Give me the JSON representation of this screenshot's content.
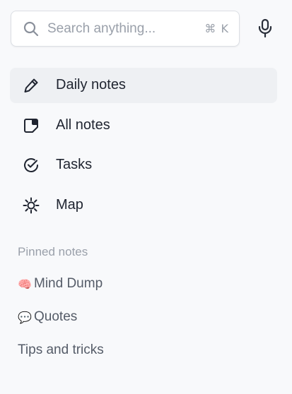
{
  "search": {
    "placeholder": "Search anything...",
    "value": "",
    "shortcut": "⌘ K",
    "icon": "search-icon"
  },
  "mic": {
    "icon": "microphone-icon"
  },
  "nav": {
    "items": [
      {
        "label": "Daily notes",
        "icon": "pencil-icon",
        "active": true
      },
      {
        "label": "All notes",
        "icon": "note-icon",
        "active": false
      },
      {
        "label": "Tasks",
        "icon": "check-circle-icon",
        "active": false
      },
      {
        "label": "Map",
        "icon": "sun-icon",
        "active": false
      }
    ]
  },
  "pinned": {
    "title": "Pinned notes",
    "items": [
      {
        "emoji": "🧠",
        "label": "Mind Dump"
      },
      {
        "emoji": "💬",
        "label": "Quotes"
      },
      {
        "emoji": "",
        "label": "Tips and tricks"
      }
    ]
  },
  "colors": {
    "background": "#f8f9fb",
    "active_bg": "#eef0f3",
    "text": "#1f2430",
    "muted": "#9aa0aa",
    "secondary": "#555c68"
  }
}
